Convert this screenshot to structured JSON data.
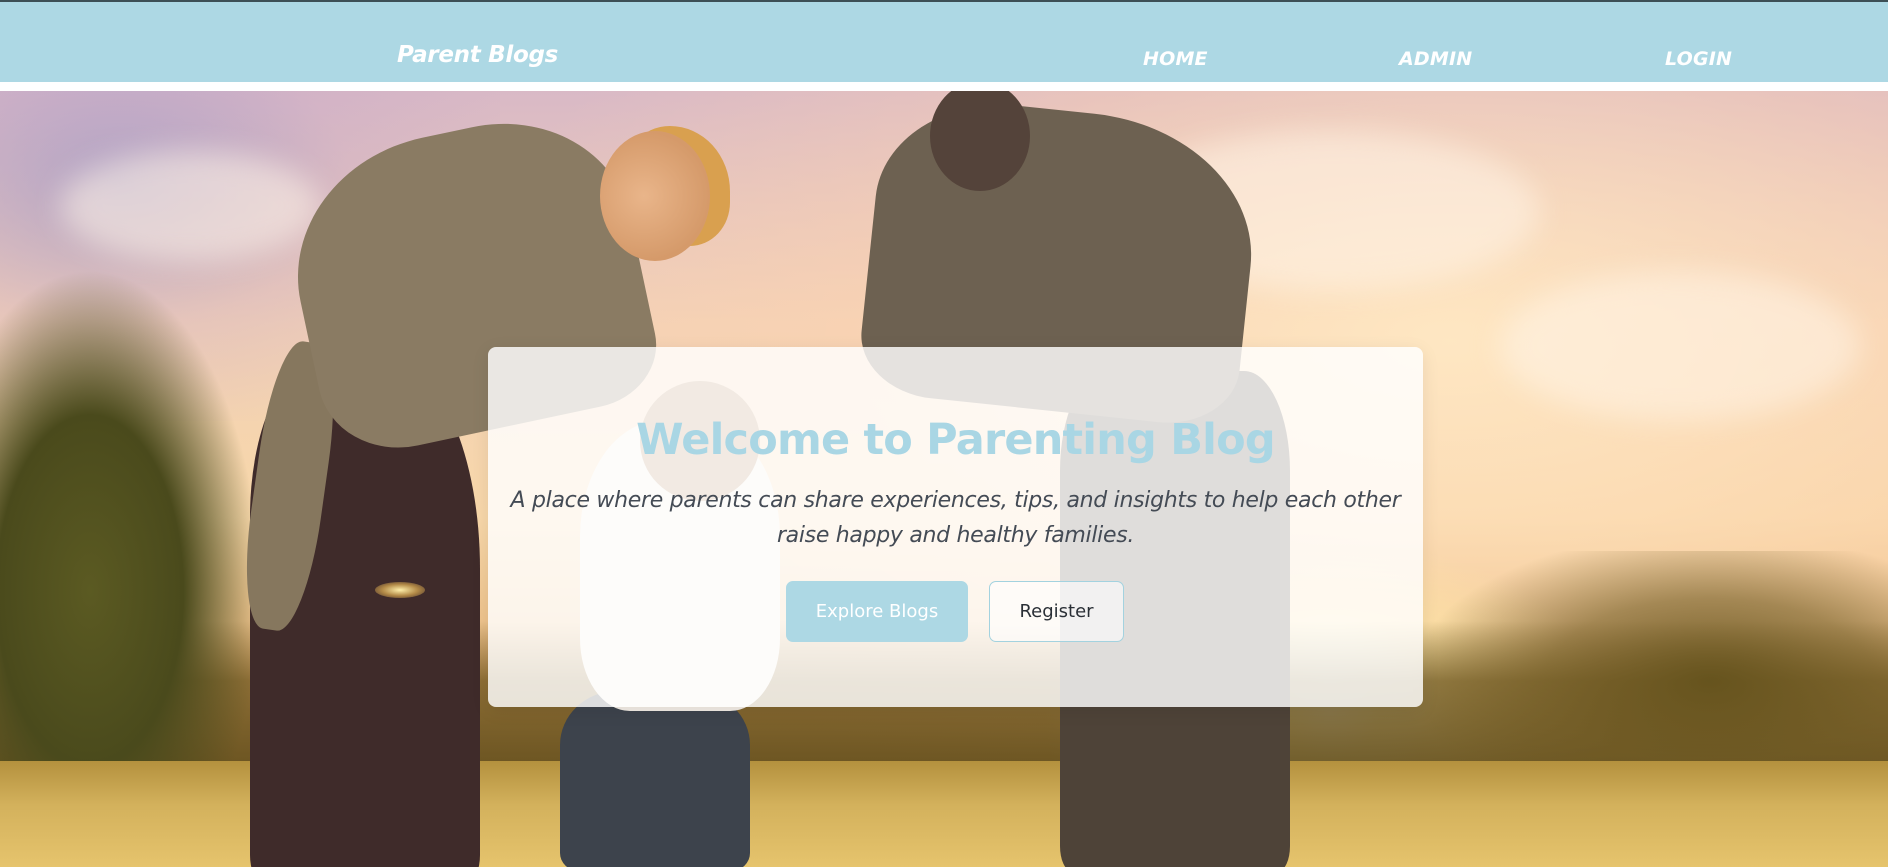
{
  "navbar": {
    "brand": "Parent Blogs",
    "links": [
      {
        "label": "HOME"
      },
      {
        "label": "ADMIN"
      },
      {
        "label": "LOGIN"
      }
    ],
    "background_color": "#add8e4"
  },
  "hero": {
    "background_image": "family-holding-hands-sunset-meadow",
    "card": {
      "title": "Welcome to Parenting Blog",
      "description": "A place where parents can share experiences, tips, and insights to help each other raise happy and healthy families.",
      "primary_button": "Explore Blogs",
      "secondary_button": "Register"
    }
  },
  "colors": {
    "accent": "#add8e4",
    "title_color": "#a9d6e4",
    "body_text": "#444b55"
  }
}
